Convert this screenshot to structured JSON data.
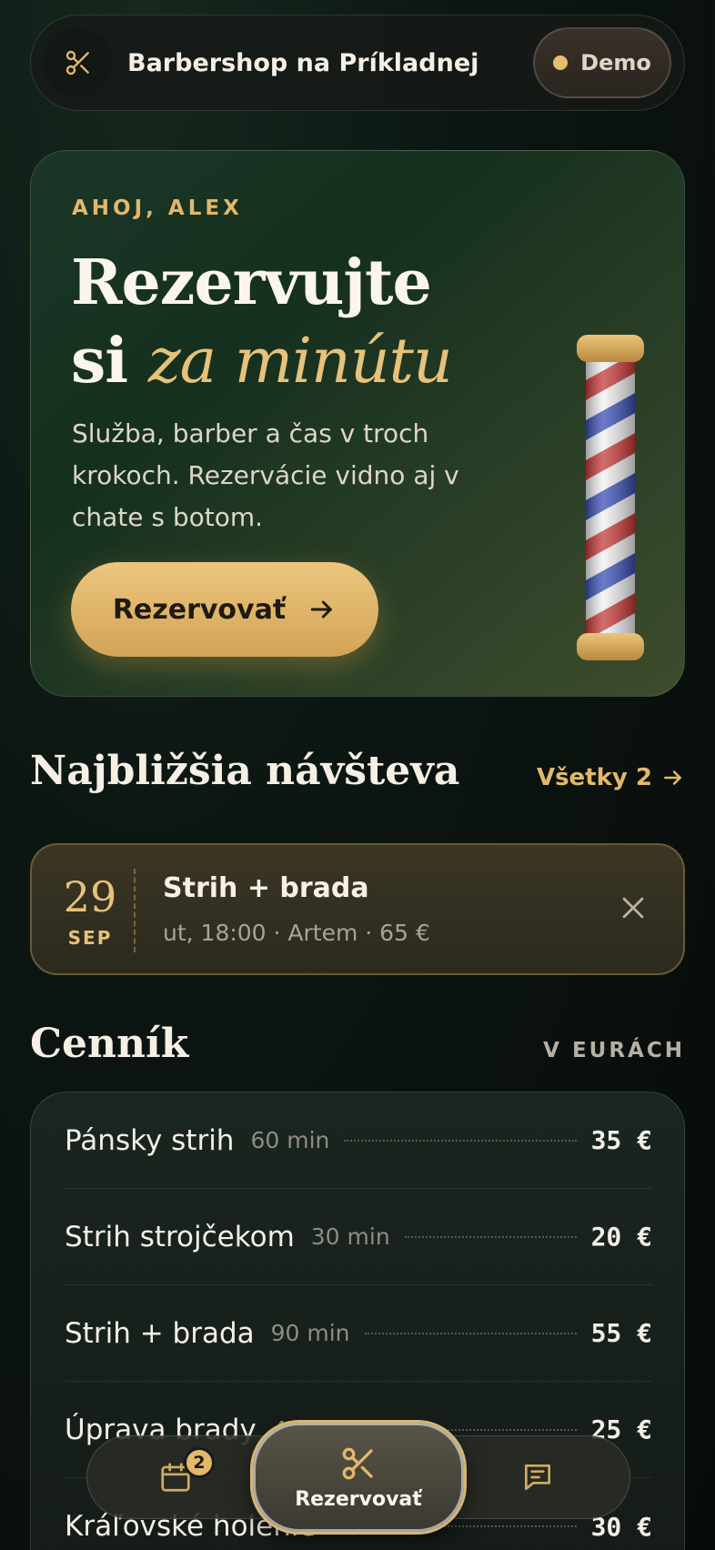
{
  "header": {
    "shop_name": "Barbershop na Príkladnej",
    "demo_label": "Demo",
    "logo_icon": "scissors-icon",
    "accent": "#e2b86b"
  },
  "hero": {
    "greeting": "AHOJ, ALEX",
    "title_line1": "Rezervujte",
    "title_line2_plain": "si",
    "title_line2_accent": "za minútu",
    "description": "Služba, barber a čas v troch krokoch. Rezervácie vidno aj v chate s botom.",
    "cta_label": "Rezervovať",
    "cta_icon": "arrow-right-icon",
    "illustration": "barber-pole"
  },
  "upcoming": {
    "section_title": "Najbližšia návšteva",
    "all_link": "Všetky 2",
    "visit": {
      "day": "29",
      "month": "SEP",
      "service": "Strih + brada",
      "meta": "ut, 18:00 · Artem · 65 €"
    }
  },
  "pricing": {
    "section_title": "Cenník",
    "currency_note": "V EURÁCH",
    "items": [
      {
        "name": "Pánsky strih",
        "duration": "60 min",
        "price": "35 €"
      },
      {
        "name": "Strih strojčekom",
        "duration": "30 min",
        "price": "20 €"
      },
      {
        "name": "Strih + brada",
        "duration": "90 min",
        "price": "55 €"
      },
      {
        "name": "Úprava brady",
        "duration": "40 min",
        "price": "25 €"
      },
      {
        "name": "Kráľovské holenie",
        "duration": "45 min",
        "price": "30 €"
      }
    ]
  },
  "bottom_nav": {
    "bookings_badge": "2",
    "center_label": "Rezervovať",
    "icons": [
      "calendar-icon",
      "scissors-icon",
      "chat-icon"
    ]
  }
}
